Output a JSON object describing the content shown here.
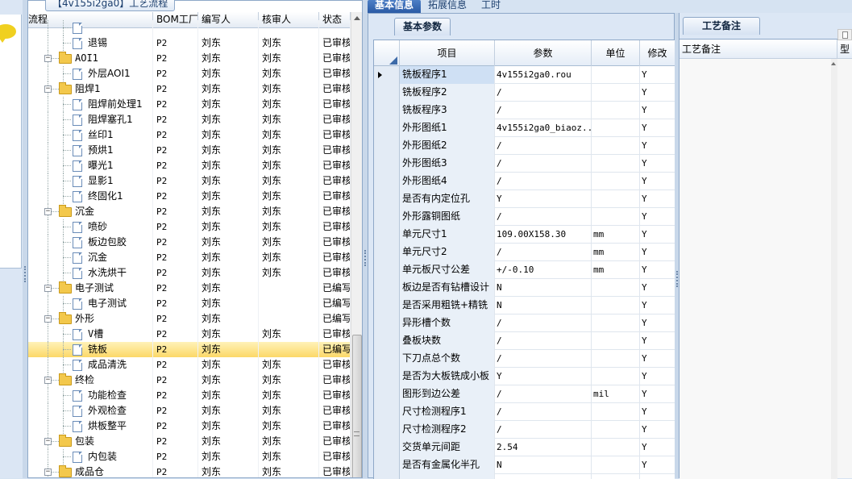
{
  "tree": {
    "panel_title": "【4v155i2ga0】工艺流程",
    "headers": {
      "name": "流程",
      "bom": "BOM工厂",
      "author": "编写人",
      "reviewer": "核审人",
      "status": "状态"
    },
    "rows": [
      {
        "level": 2,
        "kind": "doc",
        "name": "",
        "bom": "",
        "author": "",
        "reviewer": "",
        "status": "",
        "partial": true
      },
      {
        "level": 2,
        "kind": "doc",
        "name": "退锡",
        "bom": "P2",
        "author": "刘东",
        "reviewer": "刘东",
        "status": "已审核"
      },
      {
        "level": 1,
        "kind": "folder",
        "name": "AOI1",
        "bom": "P2",
        "author": "刘东",
        "reviewer": "刘东",
        "status": "已审核"
      },
      {
        "level": 2,
        "kind": "doc",
        "name": "外层AOI1",
        "bom": "P2",
        "author": "刘东",
        "reviewer": "刘东",
        "status": "已审核"
      },
      {
        "level": 1,
        "kind": "folder",
        "name": "阻焊1",
        "bom": "P2",
        "author": "刘东",
        "reviewer": "刘东",
        "status": "已审核"
      },
      {
        "level": 2,
        "kind": "doc",
        "name": "阻焊前处理1",
        "bom": "P2",
        "author": "刘东",
        "reviewer": "刘东",
        "status": "已审核"
      },
      {
        "level": 2,
        "kind": "doc",
        "name": "阻焊塞孔1",
        "bom": "P2",
        "author": "刘东",
        "reviewer": "刘东",
        "status": "已审核"
      },
      {
        "level": 2,
        "kind": "doc",
        "name": "丝印1",
        "bom": "P2",
        "author": "刘东",
        "reviewer": "刘东",
        "status": "已审核"
      },
      {
        "level": 2,
        "kind": "doc",
        "name": "预烘1",
        "bom": "P2",
        "author": "刘东",
        "reviewer": "刘东",
        "status": "已审核"
      },
      {
        "level": 2,
        "kind": "doc",
        "name": "曝光1",
        "bom": "P2",
        "author": "刘东",
        "reviewer": "刘东",
        "status": "已审核"
      },
      {
        "level": 2,
        "kind": "doc",
        "name": "显影1",
        "bom": "P2",
        "author": "刘东",
        "reviewer": "刘东",
        "status": "已审核"
      },
      {
        "level": 2,
        "kind": "doc",
        "name": "终固化1",
        "bom": "P2",
        "author": "刘东",
        "reviewer": "刘东",
        "status": "已审核"
      },
      {
        "level": 1,
        "kind": "folder",
        "name": "沉金",
        "bom": "P2",
        "author": "刘东",
        "reviewer": "刘东",
        "status": "已审核"
      },
      {
        "level": 2,
        "kind": "doc",
        "name": "喷砂",
        "bom": "P2",
        "author": "刘东",
        "reviewer": "刘东",
        "status": "已审核"
      },
      {
        "level": 2,
        "kind": "doc",
        "name": "板边包胶",
        "bom": "P2",
        "author": "刘东",
        "reviewer": "刘东",
        "status": "已审核"
      },
      {
        "level": 2,
        "kind": "doc",
        "name": "沉金",
        "bom": "P2",
        "author": "刘东",
        "reviewer": "刘东",
        "status": "已审核"
      },
      {
        "level": 2,
        "kind": "doc",
        "name": "水洗烘干",
        "bom": "P2",
        "author": "刘东",
        "reviewer": "刘东",
        "status": "已审核"
      },
      {
        "level": 1,
        "kind": "folder",
        "name": "电子测试",
        "bom": "P2",
        "author": "刘东",
        "reviewer": "",
        "status": "已编写"
      },
      {
        "level": 2,
        "kind": "doc",
        "name": "电子测试",
        "bom": "P2",
        "author": "刘东",
        "reviewer": "",
        "status": "已编写"
      },
      {
        "level": 1,
        "kind": "folder",
        "name": "外形",
        "bom": "P2",
        "author": "刘东",
        "reviewer": "",
        "status": "已编写"
      },
      {
        "level": 2,
        "kind": "doc",
        "name": "V槽",
        "bom": "P2",
        "author": "刘东",
        "reviewer": "刘东",
        "status": "已审核"
      },
      {
        "level": 2,
        "kind": "doc",
        "name": "铣板",
        "bom": "P2",
        "author": "刘东",
        "reviewer": "",
        "status": "已编写",
        "selected": true
      },
      {
        "level": 2,
        "kind": "doc",
        "name": "成品清洗",
        "bom": "P2",
        "author": "刘东",
        "reviewer": "刘东",
        "status": "已审核"
      },
      {
        "level": 1,
        "kind": "folder",
        "name": "终检",
        "bom": "P2",
        "author": "刘东",
        "reviewer": "刘东",
        "status": "已审核"
      },
      {
        "level": 2,
        "kind": "doc",
        "name": "功能检查",
        "bom": "P2",
        "author": "刘东",
        "reviewer": "刘东",
        "status": "已审核"
      },
      {
        "level": 2,
        "kind": "doc",
        "name": "外观检查",
        "bom": "P2",
        "author": "刘东",
        "reviewer": "刘东",
        "status": "已审核"
      },
      {
        "level": 2,
        "kind": "doc",
        "name": "烘板整平",
        "bom": "P2",
        "author": "刘东",
        "reviewer": "刘东",
        "status": "已审核"
      },
      {
        "level": 1,
        "kind": "folder",
        "name": "包装",
        "bom": "P2",
        "author": "刘东",
        "reviewer": "刘东",
        "status": "已审核"
      },
      {
        "level": 2,
        "kind": "doc",
        "name": "内包装",
        "bom": "P2",
        "author": "刘东",
        "reviewer": "刘东",
        "status": "已审核"
      },
      {
        "level": 1,
        "kind": "folder",
        "name": "成品仓",
        "bom": "P2",
        "author": "刘东",
        "reviewer": "刘东",
        "status": "已审核"
      },
      {
        "level": 2,
        "kind": "doc",
        "name": "",
        "bom": "",
        "author": "",
        "reviewer": "",
        "status": "",
        "partial": true
      }
    ]
  },
  "top_tabs": [
    {
      "label": "基本信息",
      "active": true
    },
    {
      "label": "拓展信息",
      "active": false
    },
    {
      "label": "工时",
      "active": false
    }
  ],
  "basic_params": {
    "subtab": "基本参数",
    "headers": {
      "item": "项目",
      "param": "参数",
      "unit": "单位",
      "modify": "修改"
    },
    "rows": [
      {
        "item": "铣板程序1",
        "param": "4v155i2ga0.rou",
        "unit": "",
        "modify": "Y",
        "current": true
      },
      {
        "item": "铣板程序2",
        "param": "/",
        "unit": "",
        "modify": "Y"
      },
      {
        "item": "铣板程序3",
        "param": "/",
        "unit": "",
        "modify": "Y"
      },
      {
        "item": "外形图纸1",
        "param": "4v155i2ga0_biaoz...",
        "unit": "",
        "modify": "Y"
      },
      {
        "item": "外形图纸2",
        "param": "/",
        "unit": "",
        "modify": "Y"
      },
      {
        "item": "外形图纸3",
        "param": "/",
        "unit": "",
        "modify": "Y"
      },
      {
        "item": "外形图纸4",
        "param": "/",
        "unit": "",
        "modify": "Y"
      },
      {
        "item": "是否有内定位孔",
        "param": "Y",
        "unit": "",
        "modify": "Y"
      },
      {
        "item": "外形露铜图纸",
        "param": "/",
        "unit": "",
        "modify": "Y"
      },
      {
        "item": "单元尺寸1",
        "param": "109.00X158.30",
        "unit": "mm",
        "modify": "Y"
      },
      {
        "item": "单元尺寸2",
        "param": "/",
        "unit": "mm",
        "modify": "Y"
      },
      {
        "item": "单元板尺寸公差",
        "param": "+/-0.10",
        "unit": "mm",
        "modify": "Y"
      },
      {
        "item": "板边是否有钻槽设计",
        "param": "N",
        "unit": "",
        "modify": "Y"
      },
      {
        "item": "是否采用粗铣+精铣",
        "param": "N",
        "unit": "",
        "modify": "Y"
      },
      {
        "item": "异形槽个数",
        "param": "/",
        "unit": "",
        "modify": "Y"
      },
      {
        "item": "叠板块数",
        "param": "/",
        "unit": "",
        "modify": "Y"
      },
      {
        "item": "下刀点总个数",
        "param": "/",
        "unit": "",
        "modify": "Y"
      },
      {
        "item": "是否为大板铣成小板",
        "param": "Y",
        "unit": "",
        "modify": "Y"
      },
      {
        "item": "图形到边公差",
        "param": "/",
        "unit": "mil",
        "modify": "Y"
      },
      {
        "item": "尺寸检测程序1",
        "param": "/",
        "unit": "",
        "modify": "Y"
      },
      {
        "item": "尺寸检测程序2",
        "param": "/",
        "unit": "",
        "modify": "Y"
      },
      {
        "item": "交货单元间距",
        "param": "2.54",
        "unit": "",
        "modify": "Y"
      },
      {
        "item": "是否有金属化半孔",
        "param": "N",
        "unit": "",
        "modify": "Y"
      },
      {
        "item": "",
        "param": "",
        "unit": "",
        "modify": "",
        "partial": true
      }
    ]
  },
  "notes": {
    "subtab": "工艺备注",
    "header_note": "工艺备注",
    "header_type": "型"
  },
  "colors": {
    "selection": "#fcd868",
    "active_tab": "#2a5aa5",
    "panel_bg": "#dce7f5"
  }
}
